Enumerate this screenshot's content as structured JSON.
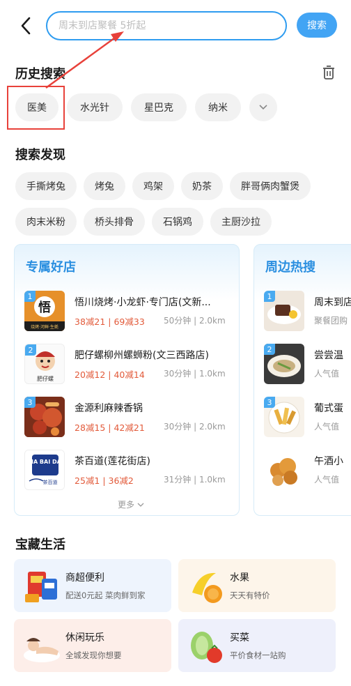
{
  "search": {
    "placeholder": "周末到店聚餐 5折起",
    "button_label": "搜索"
  },
  "history": {
    "title": "历史搜索",
    "items": [
      "医美",
      "水光针",
      "星巴克",
      "纳米"
    ]
  },
  "discover": {
    "title": "搜索发现",
    "row1": [
      "手撕烤兔",
      "烤兔",
      "鸡架",
      "奶茶",
      "胖哥俩肉蟹煲"
    ],
    "row2": [
      "肉末米粉",
      "桥头排骨",
      "石锅鸡",
      "主厨沙拉"
    ]
  },
  "exclusive": {
    "title": "专属好店",
    "more_label": "更多",
    "shops": [
      {
        "rank": "1",
        "name": "悟川烧烤·小龙虾·专门店(文新...",
        "deal": "38减21 | 69减33",
        "meta": "50分钟 | 2.0km"
      },
      {
        "rank": "2",
        "name": "肥仔螺柳州螺蛳粉(文三西路店)",
        "deal": "20减12 | 40减14",
        "meta": "30分钟 | 1.0km"
      },
      {
        "rank": "3",
        "name": "金源利麻辣香锅",
        "deal": "28减15 | 42减21",
        "meta": "30分钟 | 2.0km"
      },
      {
        "rank": "",
        "name": "茶百道(莲花街店)",
        "deal": "25减1 | 36减2",
        "meta": "31分钟 | 1.0km"
      }
    ]
  },
  "nearby": {
    "title": "周边热搜",
    "items": [
      {
        "rank": "1",
        "name": "周末到店",
        "sub": "聚餐团购"
      },
      {
        "rank": "2",
        "name": "尝尝温",
        "sub": "人气值"
      },
      {
        "rank": "3",
        "name": "葡式蛋",
        "sub": "人气值"
      },
      {
        "rank": "",
        "name": "午酒小",
        "sub": "人气值"
      }
    ]
  },
  "life": {
    "title": "宝藏生活",
    "tiles": [
      {
        "title": "商超便利",
        "sub": "配送0元起 菜肉鲜到家"
      },
      {
        "title": "水果",
        "sub": "天天有特价"
      },
      {
        "title": "休闲玩乐",
        "sub": "全城发现你想要"
      },
      {
        "title": "买菜",
        "sub": "平价食材一站购"
      }
    ]
  },
  "logo_text": {
    "shop1": "悟",
    "shop1_tag": "烧烤·河鲜·生蚝",
    "shop2": "肥仔螺",
    "shop4": "CHA BAI DAO",
    "shop4_cn": "茶百道"
  },
  "colors": {
    "accent": "#2e9cf0",
    "annotation": "#e8413a",
    "deal": "#e25a3a"
  }
}
